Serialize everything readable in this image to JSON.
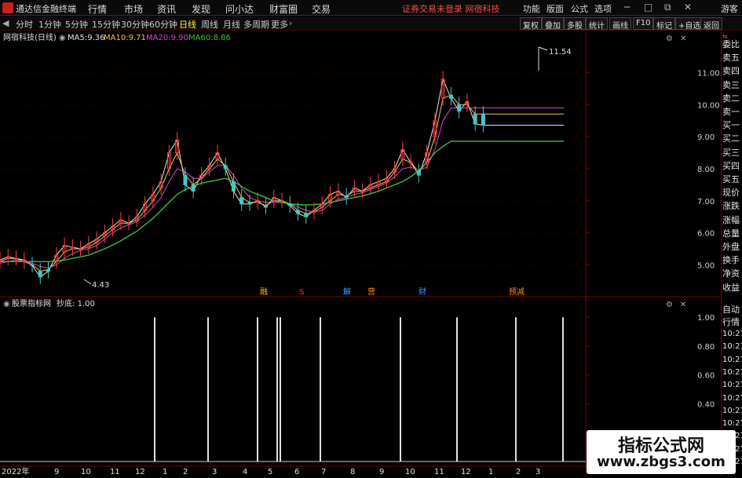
{
  "menubar": {
    "app_name": "通达信金融终端",
    "items": [
      "行情",
      "市场",
      "资讯",
      "发现",
      "问小达",
      "财富圈",
      "交易"
    ],
    "warning": "证券交易未登录  网宿科技",
    "right_items": [
      "功能",
      "版面",
      "公式",
      "选项"
    ],
    "user_label": "游客"
  },
  "toolbar": {
    "periods": [
      "分时",
      "1分钟",
      "5分钟",
      "15分钟",
      "30分钟",
      "60分钟",
      "日线",
      "周线",
      "月线",
      "多周期",
      "更多"
    ],
    "active_period": "日线",
    "right_buttons": [
      "复权",
      "叠加",
      "多股",
      "统计",
      "画线",
      "F10",
      "标记",
      "+自选",
      "返回"
    ]
  },
  "main_chart": {
    "title": "网宿科技(日线)",
    "legend": [
      {
        "label": "MA5:",
        "value": "9.36",
        "color": "#e6e6e6"
      },
      {
        "label": "MA10:",
        "value": "9.71",
        "color": "#f5c542"
      },
      {
        "label": "MA20:",
        "value": "9.90",
        "color": "#d24bd2"
      },
      {
        "label": "MA60:",
        "value": "8.86",
        "color": "#36c236"
      }
    ],
    "high_label": "11.54",
    "low_label": "4.43",
    "event_tags": [
      {
        "text": "融",
        "color": "#f0c000"
      },
      {
        "text": "S",
        "color": "#ff3030"
      },
      {
        "text": "解",
        "color": "#3aa0ff"
      },
      {
        "text": "营",
        "color": "#ff8c00"
      },
      {
        "text": "财",
        "color": "#3aa0ff"
      },
      {
        "text": "预减",
        "color": "#ff8c00"
      }
    ]
  },
  "indicator_panel": {
    "title": "股票指标网",
    "param_label": "抄底:",
    "param_value": "1.00"
  },
  "x_axis": {
    "labels": [
      "2022年",
      "9",
      "10",
      "11",
      "12",
      "1",
      "2",
      "3",
      "4",
      "5",
      "6",
      "7",
      "8",
      "9",
      "10",
      "11",
      "12",
      "1",
      "2",
      "3"
    ]
  },
  "side_panel": {
    "tags": [
      "委比",
      "卖五",
      "卖四",
      "卖三",
      "卖二",
      "卖一",
      "买一",
      "买二",
      "买三",
      "买四",
      "买五",
      "现价",
      "涨跌",
      "涨幅",
      "总量",
      "外盘",
      "换手",
      "净资",
      "收益"
    ],
    "lower_tags": [
      "自动",
      "行情"
    ],
    "times": [
      "10:27",
      "10:27",
      "10:27",
      "10:27",
      "10:27",
      "10:27",
      "10:27",
      "10:27",
      "10:27",
      "10:27",
      "10:27"
    ]
  },
  "watermark": {
    "line1": "指标公式网",
    "line2": "www.zbgs3.com"
  },
  "chart_data": [
    {
      "type": "line",
      "title": "网宿科技(日线)",
      "ylim": [
        4.2,
        11.8
      ],
      "y_ticks": [
        5.0,
        6.0,
        7.0,
        8.0,
        9.0,
        10.0,
        11.0
      ],
      "x": [
        0,
        4,
        8,
        12,
        16,
        20,
        24,
        28,
        32,
        36,
        40,
        44,
        48,
        52,
        56,
        60,
        64,
        68,
        72,
        76,
        80,
        84,
        88,
        92,
        96,
        100,
        104,
        108,
        112,
        116,
        120,
        124,
        128,
        132,
        136,
        140,
        144,
        148,
        152,
        156,
        160,
        164,
        168,
        172,
        176,
        180,
        184,
        188,
        192,
        196,
        200,
        204,
        208,
        212,
        216,
        220,
        224,
        228,
        232,
        236,
        240,
        244,
        248,
        252,
        256,
        260,
        264,
        268,
        272,
        276,
        280
      ],
      "series": [
        {
          "name": "MA5",
          "color": "#e6e6e6",
          "values": [
            5.15,
            5.25,
            5.2,
            5.15,
            4.98,
            4.62,
            4.8,
            5.3,
            5.6,
            5.55,
            5.5,
            5.65,
            5.8,
            6.0,
            6.2,
            6.4,
            6.3,
            6.5,
            6.9,
            7.2,
            7.6,
            8.5,
            8.9,
            7.5,
            7.3,
            7.8,
            8.1,
            8.5,
            8.0,
            7.3,
            6.9,
            6.9,
            7.0,
            6.8,
            7.1,
            7.0,
            6.85,
            6.6,
            6.5,
            6.7,
            6.9,
            7.2,
            7.3,
            7.1,
            7.4,
            7.3,
            7.5,
            7.6,
            7.7,
            8.0,
            8.6,
            8.2,
            7.8,
            8.5,
            9.5,
            10.8,
            10.2,
            9.8,
            10.1,
            9.4,
            9.36,
            9.36,
            9.36,
            9.36,
            9.36,
            9.36,
            9.36,
            9.36,
            9.36,
            9.36,
            9.36
          ]
        },
        {
          "name": "MA10",
          "color": "#f5c542",
          "values": [
            5.1,
            5.2,
            5.2,
            5.1,
            5.0,
            4.8,
            4.85,
            5.1,
            5.4,
            5.5,
            5.5,
            5.55,
            5.7,
            5.9,
            6.1,
            6.3,
            6.3,
            6.4,
            6.7,
            7.0,
            7.4,
            8.0,
            8.5,
            7.8,
            7.5,
            7.7,
            8.0,
            8.3,
            8.1,
            7.6,
            7.1,
            6.95,
            6.95,
            6.85,
            7.0,
            7.0,
            6.9,
            6.7,
            6.6,
            6.65,
            6.8,
            7.0,
            7.2,
            7.15,
            7.3,
            7.3,
            7.4,
            7.5,
            7.6,
            7.9,
            8.3,
            8.2,
            7.9,
            8.2,
            9.0,
            10.2,
            10.3,
            10.0,
            10.0,
            9.71,
            9.71,
            9.71,
            9.71,
            9.71,
            9.71,
            9.71,
            9.71,
            9.71,
            9.71,
            9.71,
            9.71
          ]
        },
        {
          "name": "MA20",
          "color": "#d24bd2",
          "values": [
            5.05,
            5.1,
            5.15,
            5.1,
            5.05,
            4.95,
            4.9,
            5.0,
            5.2,
            5.35,
            5.45,
            5.5,
            5.6,
            5.8,
            6.0,
            6.15,
            6.25,
            6.35,
            6.55,
            6.8,
            7.1,
            7.6,
            8.0,
            7.9,
            7.7,
            7.7,
            7.9,
            8.1,
            8.1,
            7.8,
            7.4,
            7.1,
            7.0,
            6.95,
            6.95,
            6.95,
            6.9,
            6.8,
            6.7,
            6.65,
            6.7,
            6.9,
            7.05,
            7.1,
            7.2,
            7.25,
            7.35,
            7.45,
            7.55,
            7.75,
            8.0,
            8.05,
            7.95,
            8.05,
            8.6,
            9.5,
            9.9,
            9.9,
            9.9,
            9.9,
            9.9,
            9.9,
            9.9,
            9.9,
            9.9,
            9.9,
            9.9,
            9.9,
            9.9,
            9.9,
            9.9
          ]
        },
        {
          "name": "MA60",
          "color": "#36c236",
          "values": [
            5.1,
            5.1,
            5.1,
            5.1,
            5.1,
            5.1,
            5.1,
            5.12,
            5.15,
            5.2,
            5.25,
            5.3,
            5.4,
            5.5,
            5.62,
            5.75,
            5.9,
            6.05,
            6.25,
            6.45,
            6.7,
            6.95,
            7.2,
            7.35,
            7.45,
            7.55,
            7.6,
            7.65,
            7.7,
            7.6,
            7.45,
            7.3,
            7.2,
            7.1,
            7.0,
            6.95,
            6.9,
            6.88,
            6.87,
            6.88,
            6.9,
            6.95,
            7.0,
            7.05,
            7.1,
            7.15,
            7.22,
            7.3,
            7.4,
            7.5,
            7.6,
            7.75,
            7.95,
            8.2,
            8.5,
            8.7,
            8.86,
            8.86,
            8.86,
            8.86,
            8.86,
            8.86,
            8.86,
            8.86,
            8.86,
            8.86,
            8.86,
            8.86,
            8.86,
            8.86,
            8.86
          ]
        }
      ]
    },
    {
      "type": "bar",
      "title": "股票指标网",
      "ylim": [
        0,
        1.05
      ],
      "y_ticks": [
        0.2,
        0.4,
        0.6,
        0.8,
        1.0
      ],
      "signals": [
        {
          "x": 197,
          "value": 1.0
        },
        {
          "x": 265,
          "value": 1.0
        },
        {
          "x": 328,
          "value": 1.0
        },
        {
          "x": 353,
          "value": 1.0
        },
        {
          "x": 357,
          "value": 1.0
        },
        {
          "x": 408,
          "value": 1.0
        },
        {
          "x": 510,
          "value": 1.0
        },
        {
          "x": 582,
          "value": 1.0
        },
        {
          "x": 657,
          "value": 1.0
        },
        {
          "x": 717,
          "value": 1.0
        }
      ]
    }
  ]
}
